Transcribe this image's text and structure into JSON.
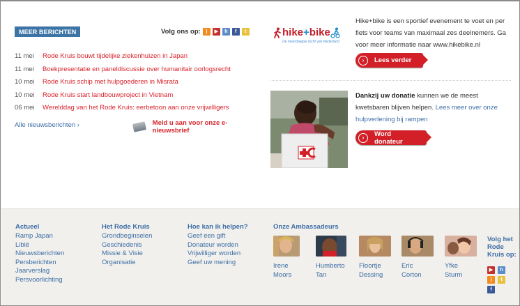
{
  "news": {
    "meer_label": "MEER BERICHTEN",
    "volg_label": "Volg ons op:",
    "social_icons": [
      "rss-icon",
      "youtube-icon",
      "hyves-icon",
      "facebook-icon",
      "twitter-icon"
    ],
    "items": [
      {
        "date": "11 mei",
        "title": "Rode Kruis bouwt tijdelijke ziekenhuizen in Japan"
      },
      {
        "date": "11 mei",
        "title": "Boekpresentatie en paneldiscussie over humanitair oorlogsrecht"
      },
      {
        "date": "10 mei",
        "title": "Rode Kruis schip met hulpgoederen in Misrata"
      },
      {
        "date": "10 mei",
        "title": "Rode Kruis start landbouwproject in Vietnam"
      },
      {
        "date": "06 mei",
        "title": "Werelddag van het Rode Kruis: eerbetoon aan onze vrijwilligers"
      }
    ],
    "alle_label": "Alle nieuwsberichten",
    "meld_label": "Meld u aan voor onze e-nieuwsbrief"
  },
  "hikebike": {
    "logo_hike": "hike",
    "logo_plus": "+",
    "logo_bike": "bike",
    "tagline": "De meerdaagse tocht van Nederland",
    "text": "Hike+bike is een sportief evenement te voet en per fiets voor teams van maximaal zes deelnemers. Ga voor meer informatie naar www.hikebike.nl",
    "button": "Lees verder"
  },
  "donatie": {
    "bold": "Dankzij uw donatie",
    "text": " kunnen we de meest kwetsbaren blijven helpen. ",
    "link": "Lees meer over onze hulpverlening bij rampen",
    "button": "Word donateur"
  },
  "footer": {
    "columns": [
      {
        "title": "Actueel",
        "links": [
          "Ramp Japan",
          "Libië",
          "Nieuwsberichten",
          "Persberichten",
          "Jaarverslag",
          "Persvoorlichting"
        ]
      },
      {
        "title": "Het Rode Kruis",
        "links": [
          "Grondbeginselen",
          "Geschiedenis",
          "Missie & Visie",
          "Organisatie"
        ]
      },
      {
        "title": "Hoe kan ik helpen?",
        "links": [
          "Geef een gift",
          "Donateur worden",
          "Vrijwilliger worden",
          "Geef uw mening"
        ]
      }
    ],
    "ambassadors_title": "Onze Ambassadeurs",
    "ambassadors": [
      {
        "first": "Irene",
        "last": "Moors"
      },
      {
        "first": "Humberto",
        "last": "Tan"
      },
      {
        "first": "Floortje",
        "last": "Dessing"
      },
      {
        "first": "Eric",
        "last": "Corton"
      },
      {
        "first": "Yfke",
        "last": "Sturm"
      }
    ],
    "volg_het": "Volg het Rode Kruis op:"
  },
  "colors": {
    "accent_red": "#d8242c",
    "link_blue": "#3d6ea6",
    "button_blue": "#3c74a6"
  }
}
